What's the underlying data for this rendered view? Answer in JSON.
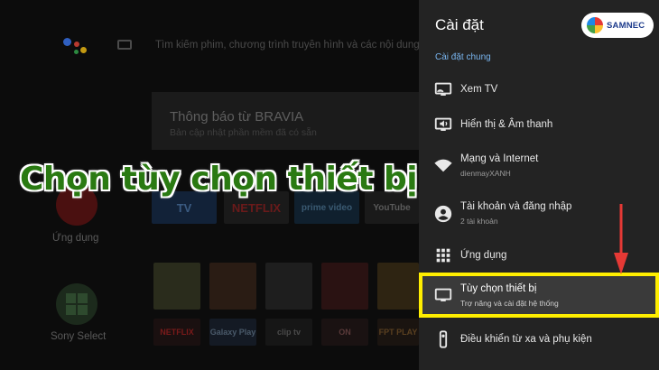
{
  "home": {
    "search_placeholder": "Tìm kiếm phim, chương trình truyền hình và các nội dung khác",
    "notice_title": "Thông báo từ BRAVIA",
    "notice_subtitle": "Bản cập nhật phần mềm đã có sẵn",
    "apps_label": "Ứng dụng",
    "sony_select_label": "Sony Select",
    "app_tiles": [
      "TV",
      "NETFLIX",
      "prime video",
      "YouTube"
    ],
    "content_row": [
      "NETFLIX",
      "Galaxy Play",
      "clip tv",
      "ON",
      "FPT PLAY"
    ]
  },
  "caption": "Chọn tùy chọn thiết bị",
  "panel": {
    "title": "Cài đặt",
    "logo_text": "SAMNEC",
    "section": "Cài đặt chung",
    "items": [
      {
        "icon": "tv-icon",
        "label": "Xem TV",
        "sub": ""
      },
      {
        "icon": "display-sound-icon",
        "label": "Hiển thị & Âm thanh",
        "sub": ""
      },
      {
        "icon": "wifi-icon",
        "label": "Mạng và Internet",
        "sub": "dienmayXANH"
      },
      {
        "icon": "account-icon",
        "label": "Tài khoản và đăng nhập",
        "sub": "2 tài khoản"
      },
      {
        "icon": "apps-grid-icon",
        "label": "Ứng dụng",
        "sub": ""
      },
      {
        "icon": "monitor-icon",
        "label": "Tùy chọn thiết bị",
        "sub": "Trợ năng và cài đặt hệ thống"
      },
      {
        "icon": "remote-icon",
        "label": "Điều khiển từ xa và phụ kiện",
        "sub": ""
      }
    ]
  },
  "colors": {
    "highlight": "#ffee00",
    "arrow": "#e53935",
    "caption_fill": "#2a7a12",
    "section_label": "#78b4ee"
  }
}
